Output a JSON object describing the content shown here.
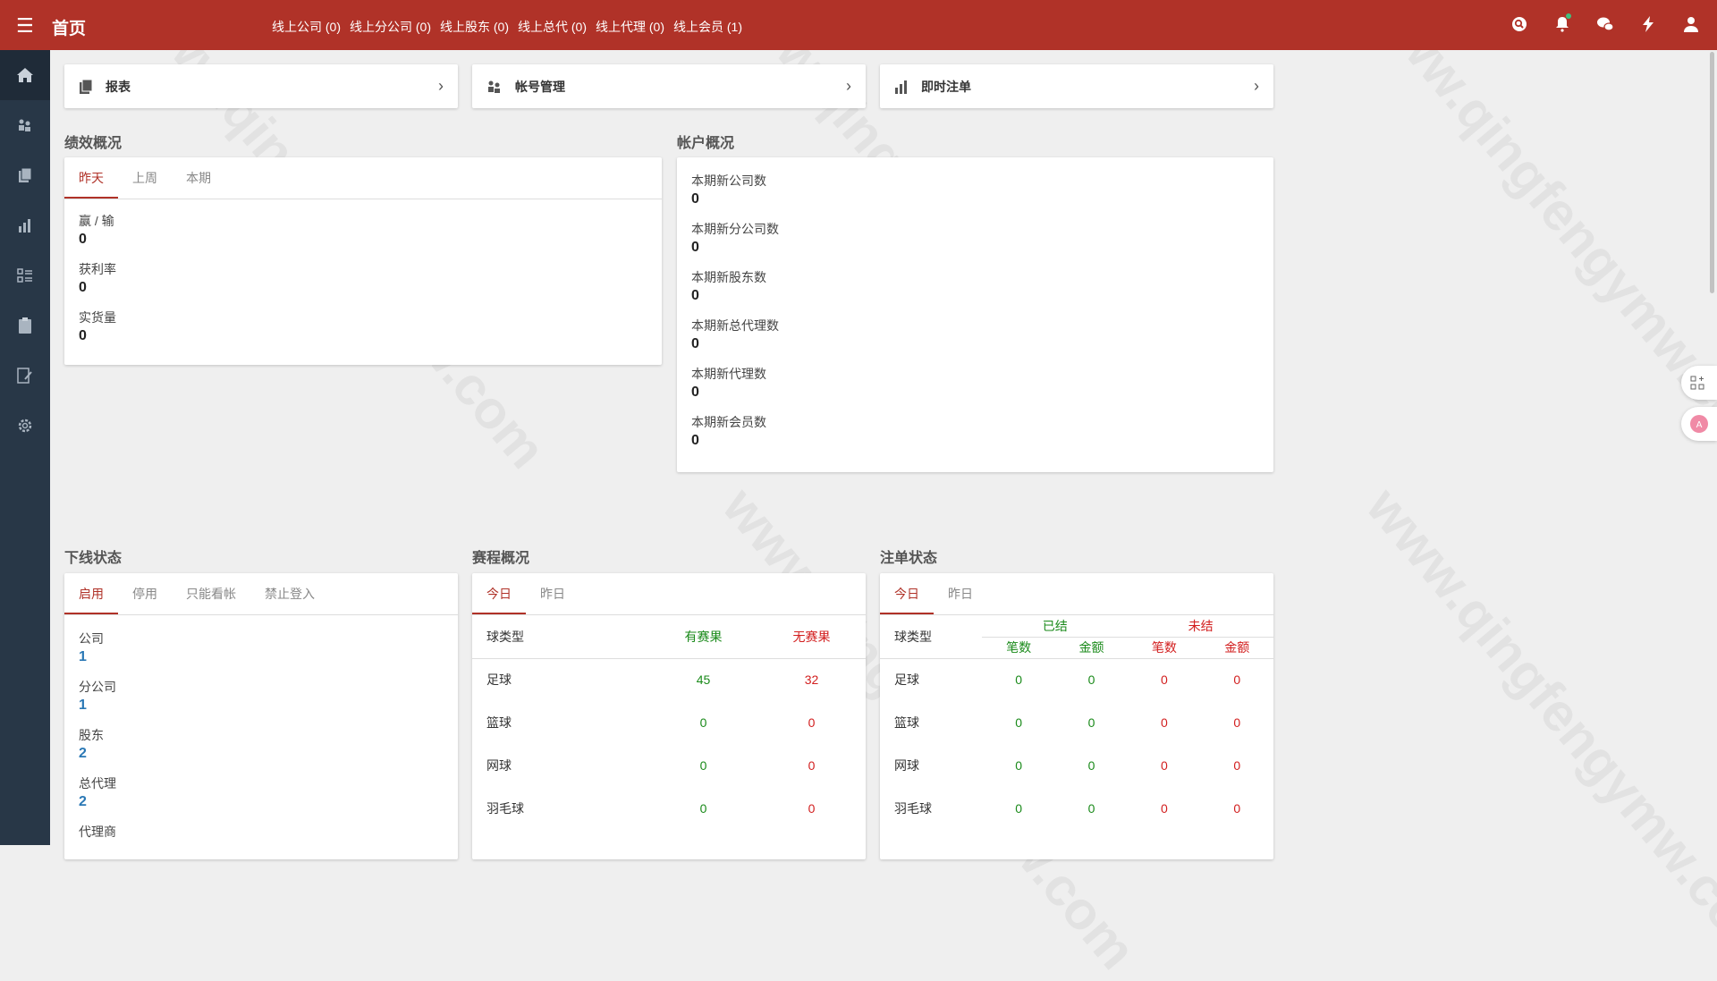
{
  "header": {
    "title": "首页",
    "stats": [
      "线上公司 (0)",
      "线上分公司 (0)",
      "线上股东 (0)",
      "线上总代 (0)",
      "线上代理 (0)",
      "线上会员 (1)"
    ]
  },
  "nav_cards": [
    {
      "label": "报表",
      "icon": "report-icon"
    },
    {
      "label": "帐号管理",
      "icon": "users-icon"
    },
    {
      "label": "即时注单",
      "icon": "bar-chart-icon"
    }
  ],
  "performance": {
    "title": "绩效概况",
    "tabs": [
      "昨天",
      "上周",
      "本期"
    ],
    "items": [
      {
        "k": "赢 / 输",
        "v": "0"
      },
      {
        "k": "获利率",
        "v": "0"
      },
      {
        "k": "实货量",
        "v": "0"
      }
    ]
  },
  "account": {
    "title": "帐户概况",
    "items": [
      {
        "k": "本期新公司数",
        "v": "0"
      },
      {
        "k": "本期新分公司数",
        "v": "0"
      },
      {
        "k": "本期新股东数",
        "v": "0"
      },
      {
        "k": "本期新总代理数",
        "v": "0"
      },
      {
        "k": "本期新代理数",
        "v": "0"
      },
      {
        "k": "本期新会员数",
        "v": "0"
      }
    ]
  },
  "downline": {
    "title": "下线状态",
    "tabs": [
      "启用",
      "停用",
      "只能看帐",
      "禁止登入"
    ],
    "items": [
      {
        "k": "公司",
        "v": "1"
      },
      {
        "k": "分公司",
        "v": "1"
      },
      {
        "k": "股东",
        "v": "2"
      },
      {
        "k": "总代理",
        "v": "2"
      },
      {
        "k": "代理商",
        "v": ""
      }
    ]
  },
  "schedule": {
    "title": "赛程概况",
    "tabs": [
      "今日",
      "昨日"
    ],
    "headers": [
      "球类型",
      "有赛果",
      "无赛果"
    ],
    "rows": [
      [
        "足球",
        "45",
        "32"
      ],
      [
        "篮球",
        "0",
        "0"
      ],
      [
        "网球",
        "0",
        "0"
      ],
      [
        "羽毛球",
        "0",
        "0"
      ]
    ]
  },
  "bets": {
    "title": "注单状态",
    "tabs": [
      "今日",
      "昨日"
    ],
    "type_header": "球类型",
    "settled": "已结",
    "unsettled": "未结",
    "sub": [
      "笔数",
      "金额",
      "笔数",
      "金额"
    ],
    "rows": [
      [
        "足球",
        "0",
        "0",
        "0",
        "0"
      ],
      [
        "篮球",
        "0",
        "0",
        "0",
        "0"
      ],
      [
        "网球",
        "0",
        "0",
        "0",
        "0"
      ],
      [
        "羽毛球",
        "0",
        "0",
        "0",
        "0"
      ]
    ]
  },
  "watermark": "www.qingfengymw.com 清风源码"
}
